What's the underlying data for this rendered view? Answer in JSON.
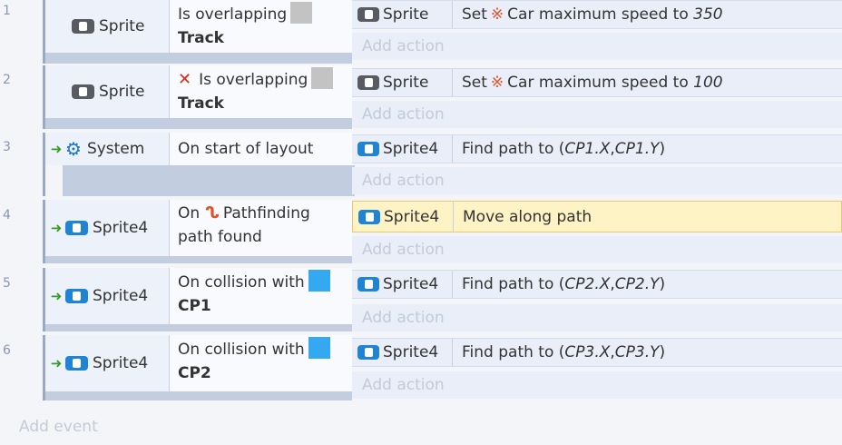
{
  "events": [
    {
      "number": "1",
      "condition": {
        "object": "Sprite",
        "object_icon": "sprite-gray-icon",
        "trigger": false,
        "inverted": false,
        "text": "Is overlapping",
        "swatch_color": "#c3c3c3",
        "target": "Track"
      },
      "action": {
        "object": "Sprite",
        "object_icon": "sprite-gray-icon",
        "prefix": "Set",
        "behavior_icon": "car-behavior-icon",
        "text": "Car maximum speed to",
        "param": "350"
      }
    },
    {
      "number": "2",
      "condition": {
        "object": "Sprite",
        "object_icon": "sprite-gray-icon",
        "trigger": false,
        "inverted": true,
        "text": "Is overlapping",
        "swatch_color": "#c3c3c3",
        "target": "Track"
      },
      "action": {
        "object": "Sprite",
        "object_icon": "sprite-gray-icon",
        "prefix": "Set",
        "behavior_icon": "car-behavior-icon",
        "text": "Car maximum speed to",
        "param": "100"
      }
    },
    {
      "number": "3",
      "condition": {
        "object": "System",
        "object_icon": "gear-icon",
        "trigger": true,
        "inverted": false,
        "text": "On start of layout"
      },
      "action": {
        "object": "Sprite4",
        "object_icon": "sprite-blue-icon",
        "text": "Find path to (",
        "param": "CP1.X",
        "sep": ", ",
        "param2": "CP1.Y",
        "close": ")"
      }
    },
    {
      "number": "4",
      "condition": {
        "object": "Sprite4",
        "object_icon": "sprite-blue-icon",
        "trigger": true,
        "inverted": false,
        "prefix": "On",
        "behavior_icon": "pathfinding-icon",
        "text": "Pathfinding",
        "text2": "path found"
      },
      "action": {
        "object": "Sprite4",
        "object_icon": "sprite-blue-icon",
        "text": "Move along path",
        "selected": true
      }
    },
    {
      "number": "5",
      "condition": {
        "object": "Sprite4",
        "object_icon": "sprite-blue-icon",
        "trigger": true,
        "inverted": false,
        "text": "On collision with",
        "swatch_color": "#34a9f1",
        "target": "CP1"
      },
      "action": {
        "object": "Sprite4",
        "object_icon": "sprite-blue-icon",
        "text": "Find path to (",
        "param": "CP2.X",
        "sep": ", ",
        "param2": "CP2.Y",
        "close": ")"
      }
    },
    {
      "number": "6",
      "condition": {
        "object": "Sprite4",
        "object_icon": "sprite-blue-icon",
        "trigger": true,
        "inverted": false,
        "text": "On collision with",
        "swatch_color": "#34a9f1",
        "target": "CP2"
      },
      "action": {
        "object": "Sprite4",
        "object_icon": "sprite-blue-icon",
        "text": "Find path to (",
        "param": "CP3.X",
        "sep": ", ",
        "param2": "CP3.Y",
        "close": ")"
      }
    }
  ],
  "add_action_label": "Add action",
  "add_event_label": "Add event",
  "glyphs": {
    "trigger_arrow": "➜",
    "gear": "⚙",
    "invert_x": "✕",
    "pathfinding": "ᔐ",
    "car": "※"
  },
  "colors": {
    "selected_action_bg": "#fdf3c4",
    "gutter": "#c2cde0"
  }
}
